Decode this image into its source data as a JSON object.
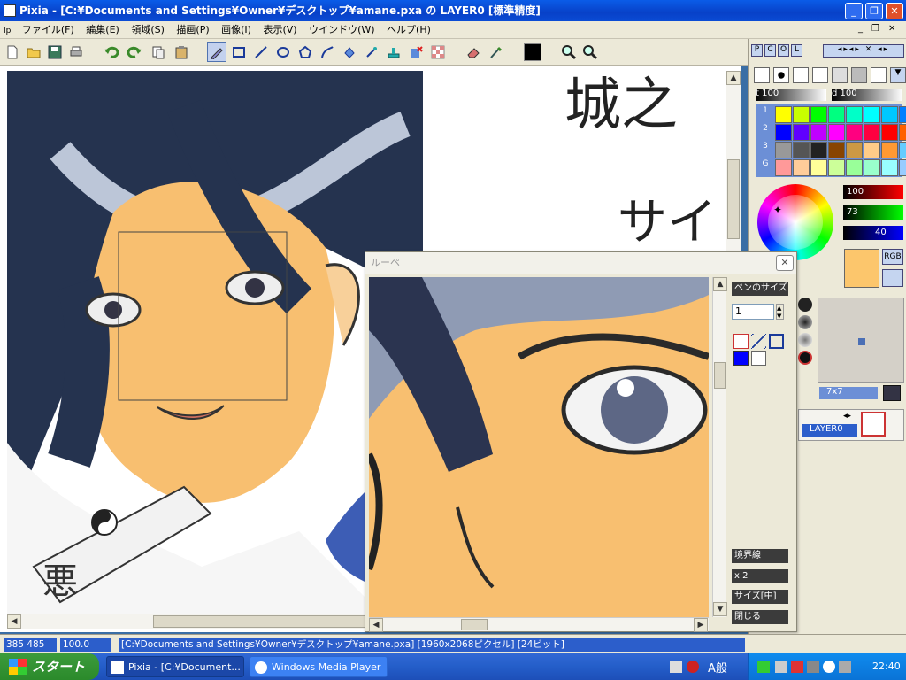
{
  "titlebar": {
    "title": "Pixia - [C:¥Documents and Settings¥Owner¥デスクトップ¥amane.pxa の LAYER0 [標準精度]",
    "minimize": "_",
    "restore": "❐",
    "close": "✕"
  },
  "menubar": {
    "doc_icon": "Ip",
    "items": [
      "ファイル(F)",
      "編集(E)",
      "領域(S)",
      "描画(P)",
      "画像(I)",
      "表示(V)",
      "ウインドウ(W)",
      "ヘルプ(H)"
    ],
    "child_min": "_",
    "child_restore": "❐",
    "child_close": "✕"
  },
  "toolbar": {
    "tools": [
      "new-icon",
      "open-icon",
      "save-icon",
      "print-icon",
      "undo-icon",
      "redo-icon",
      "copy-icon",
      "paste-icon",
      "pen-icon",
      "rectangle-icon",
      "line-icon",
      "ellipse-icon",
      "polygon-icon",
      "curve-icon",
      "fill-icon",
      "magic-wand-icon",
      "stamp-icon",
      "clear-icon",
      "grid-icon",
      "eraser-icon",
      "brush-icon",
      "color-swatch-icon",
      "zoom-in-icon",
      "zoom-out-icon"
    ]
  },
  "canvas": {
    "text_line1": "城之",
    "text_line2": "サイ",
    "talisman_text": "悪"
  },
  "right_panel": {
    "tabs": [
      "P",
      "C",
      "O",
      "L"
    ],
    "opacity_label_t": "t",
    "opacity_value_t": "100",
    "opacity_label_d": "d",
    "opacity_value_d": "100",
    "palette_rows": [
      "1",
      "2",
      "3",
      "G"
    ],
    "palette_colors": [
      [
        "#ffff00",
        "#c8ff00",
        "#00ff00",
        "#00ff80",
        "#00ffc8",
        "#00ffff",
        "#00c8ff",
        "#0080ff"
      ],
      [
        "#0000ff",
        "#6000ff",
        "#c000ff",
        "#ff00ff",
        "#ff0080",
        "#ff0040",
        "#ff0000",
        "#ff6000"
      ],
      [
        "#999999",
        "#555555",
        "#222222",
        "#884400",
        "#cc9944",
        "#ffcc88",
        "#ff9933",
        "#66ccff"
      ],
      [
        "#ff9999",
        "#ffcc99",
        "#ffff99",
        "#ccff99",
        "#99ff99",
        "#99ffcc",
        "#99ffff",
        "#99ccff"
      ]
    ],
    "r_value": "100",
    "g_value": "73",
    "b_value": "40",
    "rgb_label": "RGB",
    "current_color": "#fcc66c",
    "brush_size_label": "7x7",
    "layer_name": "LAYER0"
  },
  "loupe": {
    "title": "ルーペ",
    "pen_size_label": "ペンのサイズ",
    "pen_size_value": "1",
    "border_label": "境界線",
    "zoom_label": "x 2",
    "size_label": "サイズ[中]",
    "close_label": "閉じる",
    "close_x": "✕"
  },
  "statusbar": {
    "coords": "385 485",
    "zoom": "100.0",
    "file_info": "[C:¥Documents and Settings¥Owner¥デスクトップ¥amane.pxa] [1960x2068ピクセル] [24ビット]"
  },
  "taskbar": {
    "start_label": "スタート",
    "tasks": [
      "Pixia - [C:¥Document...",
      "Windows Media Player"
    ],
    "ime": "A般",
    "clock": "22:40"
  }
}
